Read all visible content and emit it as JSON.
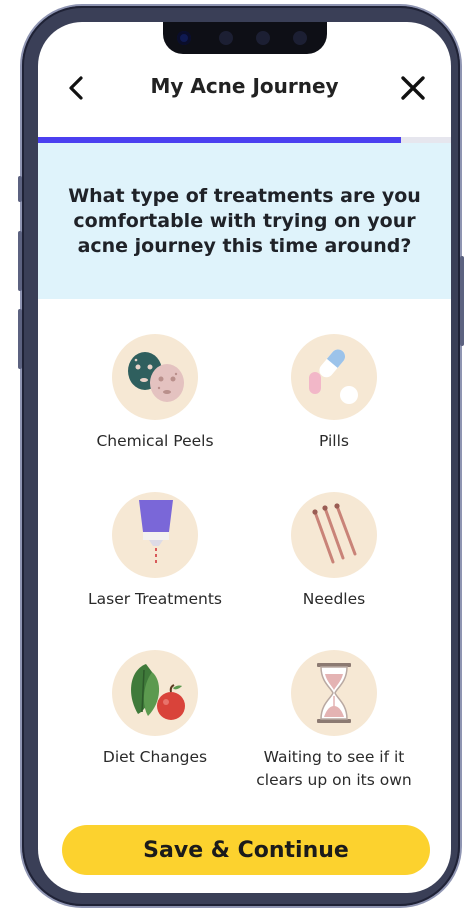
{
  "header": {
    "title": "My Acne Journey"
  },
  "progress": {
    "fraction": 0.88
  },
  "question": {
    "text": "What type of treatments are you comfortable with trying on your acne journey this time around?"
  },
  "options": [
    {
      "label": "Chemical Peels",
      "icon": "face-mask-icon"
    },
    {
      "label": "Pills",
      "icon": "pills-icon"
    },
    {
      "label": "Laser Treatments",
      "icon": "laser-icon"
    },
    {
      "label": "Needles",
      "icon": "needles-icon"
    },
    {
      "label": "Diet Changes",
      "icon": "vegetables-icon"
    },
    {
      "label": "Waiting to see if it clears up on its own",
      "icon": "hourglass-icon"
    }
  ],
  "cta": {
    "label": "Save & Continue"
  },
  "colors": {
    "accent": "#4b3ff0",
    "question_bg": "#dff3fb",
    "icon_bg": "#f6e8d4",
    "cta_bg": "#fcd22e"
  }
}
